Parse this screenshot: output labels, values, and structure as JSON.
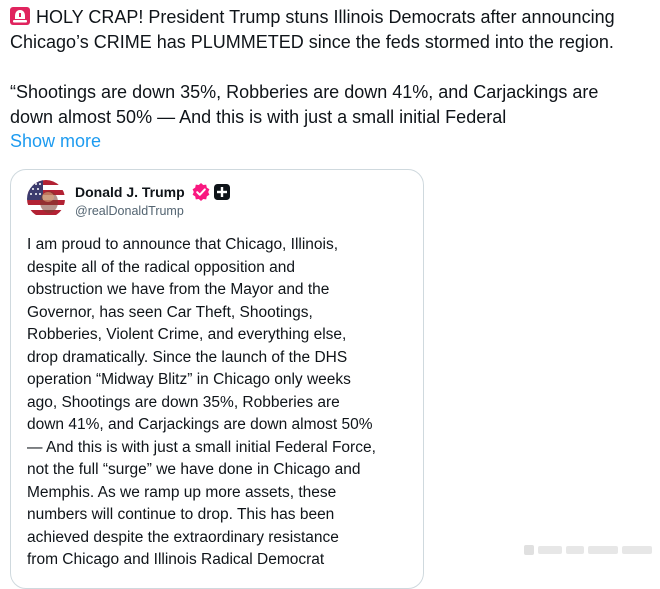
{
  "tweet": {
    "lines": [
      "HOLY CRAP! President Trump stuns Illinois Democrats after announcing",
      "Chicago’s CRIME has PLUMMETED since the feds stormed into the region.",
      "“Shootings are down 35%, Robberies are down 41%, and Carjackings are",
      "down almost 50% — And this is with just a small initial Federal"
    ],
    "show_more": "Show more",
    "emoji_icon": "police-siren-icon"
  },
  "quote": {
    "author_name": "Donald J. Trump",
    "author_handle": "@realDonaldTrump",
    "verified_icon": "verified-badge-icon",
    "affiliation_icon": "truth-social-icon",
    "body_lines": [
      "I am proud to announce that Chicago, Illinois,",
      "despite all of the radical opposition and",
      "obstruction we have from the Mayor and the",
      "Governor, has seen Car Theft, Shootings,",
      "Robberies, Violent Crime, and everything else,",
      "drop dramatically. Since the launch of the DHS",
      "operation “Midway Blitz” in Chicago only weeks",
      "ago, Shootings are down 35%, Robberies are",
      "down 41%, and Carjackings are down almost 50%",
      "— And this is with just a small initial Federal Force,",
      "not the full “surge” we have done in Chicago and",
      "Memphis. As we ramp up more assets, these",
      "numbers will continue to drop. This has been",
      "achieved despite the extraordinary resistance",
      "from Chicago and Illinois Radical Democrat"
    ]
  },
  "colors": {
    "link": "#1d9bf0",
    "text": "#0f1419",
    "muted": "#536471",
    "border": "#cfd9de",
    "verified": "#f91880",
    "siren": "#e0245e"
  }
}
